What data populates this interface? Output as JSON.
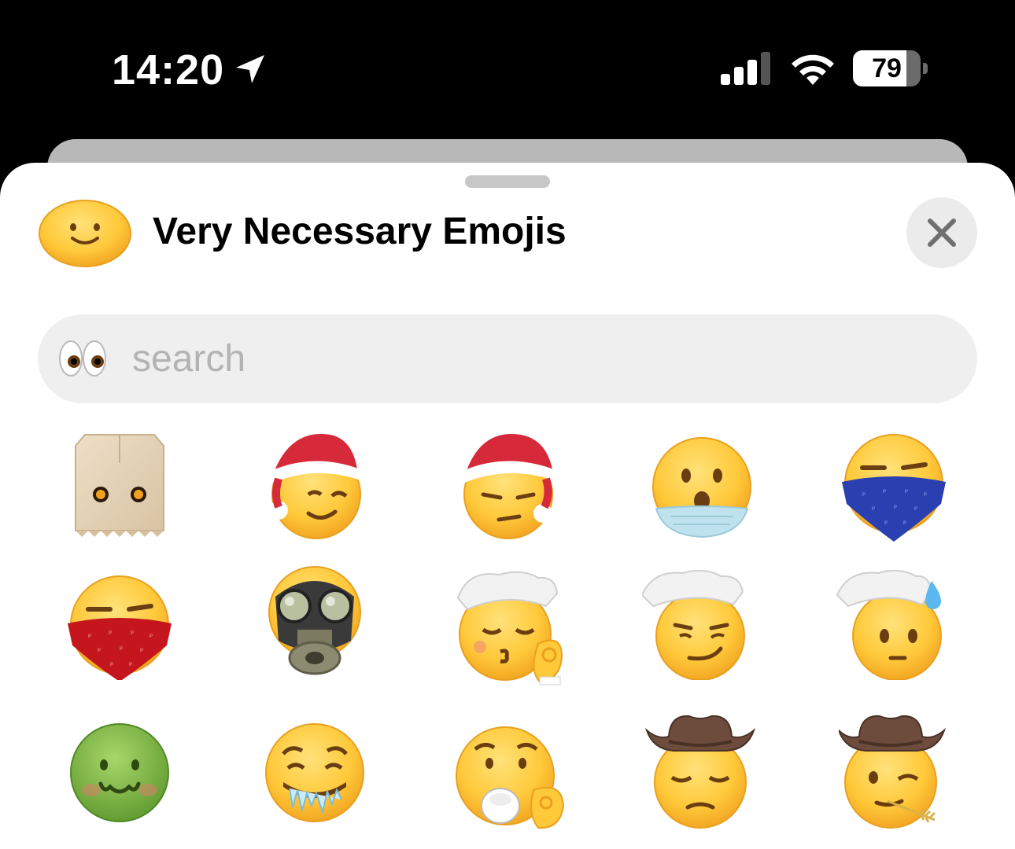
{
  "status_bar": {
    "time": "14:20",
    "battery": "79",
    "battery_level_percent": 79,
    "icons": [
      "location-arrow-icon",
      "cellular-signal-icon",
      "wifi-icon",
      "battery-icon"
    ]
  },
  "sheet": {
    "title": "Very Necessary Emojis",
    "title_icon": "slightly-smiling-face-icon",
    "close_icon": "close-icon",
    "search": {
      "placeholder": "search",
      "value": "",
      "icon": "eyes-icon"
    },
    "emojis": [
      {
        "icon": "paper-bag-face-emoji"
      },
      {
        "icon": "santa-hat-winking-face-emoji"
      },
      {
        "icon": "santa-hat-unamused-face-emoji"
      },
      {
        "icon": "surprised-face-with-medical-mask-emoji"
      },
      {
        "icon": "blue-bandana-face-emoji"
      },
      {
        "icon": "red-bandana-face-emoji"
      },
      {
        "icon": "gas-mask-face-emoji"
      },
      {
        "icon": "chef-kiss-face-emoji"
      },
      {
        "icon": "chef-smirking-face-emoji"
      },
      {
        "icon": "chef-nervous-sweat-face-emoji"
      },
      {
        "icon": "nauseated-green-face-emoji"
      },
      {
        "icon": "drooling-icicle-face-emoji"
      },
      {
        "icon": "sipping-tea-face-emoji"
      },
      {
        "icon": "cowboy-pensive-face-emoji"
      },
      {
        "icon": "cowboy-wheat-winking-face-emoji"
      }
    ]
  },
  "colors": {
    "emoji_yellow": "#FFCB3D",
    "emoji_outline": "#E8A317",
    "santa_red": "#D6293A",
    "chef_white": "#F2F2F2",
    "bandana_blue": "#2A3FB0",
    "bandana_red": "#C4161C",
    "nauseated_green": "#7CB342",
    "hat_brown": "#6D4C3D"
  }
}
